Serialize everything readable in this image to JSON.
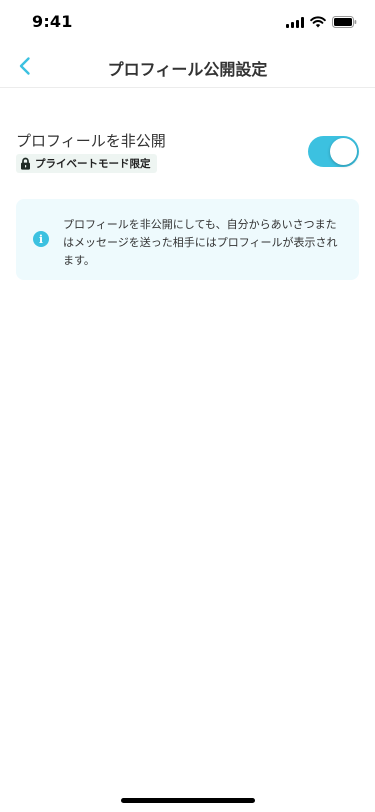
{
  "status_bar": {
    "time": "9:41"
  },
  "nav": {
    "title": "プロフィール公開設定",
    "back_icon": "chevron-left-icon"
  },
  "setting": {
    "label": "プロフィールを非公開",
    "badge": "プライベートモード限定",
    "badge_icon": "lock-icon",
    "toggle_on": true
  },
  "info": {
    "icon": "info-icon",
    "text": "プロフィールを非公開にしても、自分からあいさつまたはメッセージを送った相手にはプロフィールが表示されます。"
  },
  "colors": {
    "accent": "#3cc1e0",
    "info_bg": "#eefafd",
    "badge_bg": "#eef5f2"
  }
}
